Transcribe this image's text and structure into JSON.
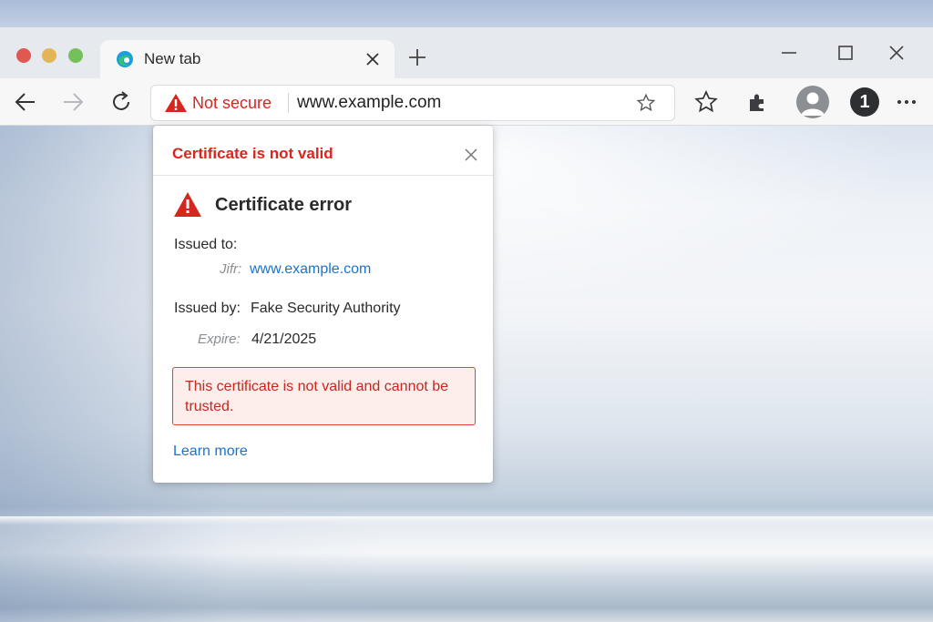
{
  "tab": {
    "title": "New tab"
  },
  "address_bar": {
    "security_label": "Not secure",
    "url": "www.example.com"
  },
  "profile": {
    "badge": "1"
  },
  "icons": {
    "back": "arrow-left-icon",
    "forward": "arrow-right-icon",
    "reload": "reload-icon",
    "favorite": "star-icon",
    "favorites": "star-outline-icon",
    "extensions": "puzzle-icon",
    "menu": "more-horizontal-icon"
  },
  "popup": {
    "title": "Certificate is not valid",
    "error_heading": "Certificate error",
    "issued_to_label": "Issued to:",
    "issued_to_sub_label": "Jifr:",
    "issued_to_value": "www.example.com",
    "issued_by_label": "Issued by:",
    "issued_by_value": "Fake Security Authority",
    "expires_label": "Expire:",
    "expires_value": "4/21/2025",
    "alert_message": "This certificate is not valid and cannot be trusted.",
    "learn_more": "Learn more"
  },
  "colors": {
    "danger": "#d7261e",
    "link": "#1a73c9",
    "alert_bg": "#fdeeec"
  }
}
